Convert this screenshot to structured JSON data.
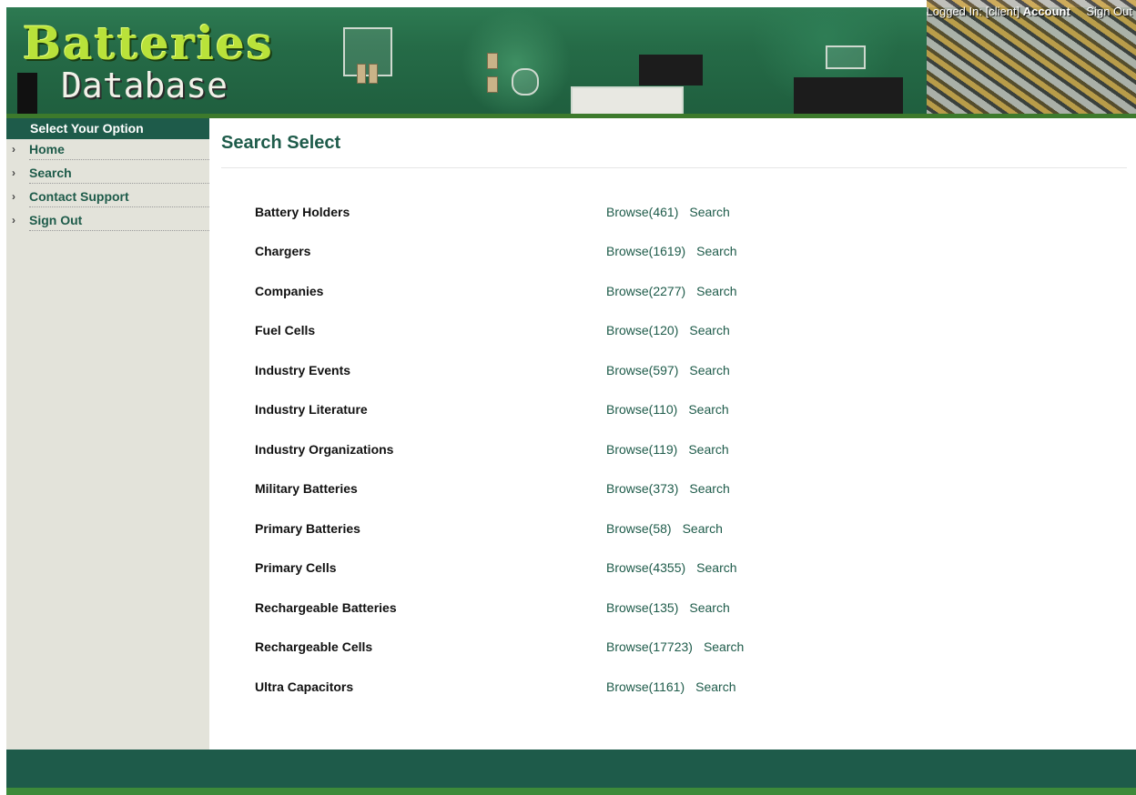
{
  "header": {
    "logo_line1": "Batteries",
    "logo_line2": "Database",
    "login_prefix": "Logged In: ",
    "login_user": "[client]",
    "account_label": "Account",
    "signout_label": "Sign Out"
  },
  "sidebar": {
    "title": "Select Your Option",
    "items": [
      {
        "label": "Home"
      },
      {
        "label": "Search"
      },
      {
        "label": "Contact Support"
      },
      {
        "label": "Sign Out"
      }
    ]
  },
  "main": {
    "title": "Search Select",
    "rows": [
      {
        "name": "Battery Holders",
        "browse": "Browse(461)",
        "search": "Search"
      },
      {
        "name": "Chargers",
        "browse": "Browse(1619)",
        "search": "Search"
      },
      {
        "name": "Companies",
        "browse": "Browse(2277)",
        "search": "Search"
      },
      {
        "name": "Fuel Cells",
        "browse": "Browse(120)",
        "search": "Search"
      },
      {
        "name": "Industry Events",
        "browse": "Browse(597)",
        "search": "Search"
      },
      {
        "name": "Industry Literature",
        "browse": "Browse(110)",
        "search": "Search"
      },
      {
        "name": "Industry Organizations",
        "browse": "Browse(119)",
        "search": "Search"
      },
      {
        "name": "Military Batteries",
        "browse": "Browse(373)",
        "search": "Search"
      },
      {
        "name": "Primary Batteries",
        "browse": "Browse(58)",
        "search": "Search"
      },
      {
        "name": "Primary Cells",
        "browse": "Browse(4355)",
        "search": "Search"
      },
      {
        "name": "Rechargeable Batteries",
        "browse": "Browse(135)",
        "search": "Search"
      },
      {
        "name": "Rechargeable Cells",
        "browse": "Browse(17723)",
        "search": "Search"
      },
      {
        "name": "Ultra Capacitors",
        "browse": "Browse(1161)",
        "search": "Search"
      }
    ]
  },
  "colors": {
    "brand_green": "#1e5b4a",
    "sidebar_bg": "#e3e3da",
    "logo_lime": "#b9e23a"
  }
}
